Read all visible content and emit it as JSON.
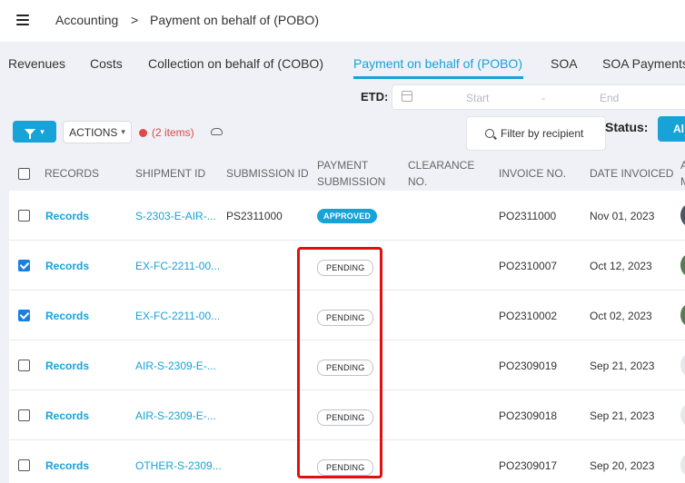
{
  "breadcrumb": {
    "parent": "Accounting",
    "separator": ">",
    "current": "Payment on behalf of (POBO)"
  },
  "tabs": [
    {
      "label": "Revenues"
    },
    {
      "label": "Costs"
    },
    {
      "label": "Collection on behalf of (COBO)"
    },
    {
      "label": "Payment on behalf of (POBO)",
      "active": true
    },
    {
      "label": "SOA"
    },
    {
      "label": "SOA Payments"
    }
  ],
  "filters": {
    "etd_label": "ETD:",
    "etd_start_placeholder": "Start",
    "etd_separator": "-",
    "etd_end_placeholder": "End",
    "actions_label": "ACTIONS",
    "items_label": "(2 items)",
    "recipient_label": "Filter by recipient",
    "status_label": "Status:",
    "status_value": "Al"
  },
  "table": {
    "headers": {
      "records": "RECORDS",
      "shipment_id": "SHIPMENT ID",
      "submission_id": "SUBMISSION ID",
      "payment_submission": "PAYMENT SUBMISSION",
      "clearance_no": "CLEARANCE NO.",
      "invoice_no": "INVOICE NO.",
      "date_invoiced": "DATE INVOICED",
      "assignee": "A M"
    },
    "rows": [
      {
        "checked": false,
        "records": "Records",
        "shipment_id": "S-2303-E-AIR-...",
        "submission_id": "PS2311000",
        "status": "APPROVED",
        "invoice_no": "PO2311000",
        "date_invoiced": "Nov 01, 2023"
      },
      {
        "checked": true,
        "records": "Records",
        "shipment_id": "EX-FC-2211-00...",
        "submission_id": "",
        "status": "PENDING",
        "invoice_no": "PO2310007",
        "date_invoiced": "Oct 12, 2023"
      },
      {
        "checked": true,
        "records": "Records",
        "shipment_id": "EX-FC-2211-00...",
        "submission_id": "",
        "status": "PENDING",
        "invoice_no": "PO2310002",
        "date_invoiced": "Oct 02, 2023"
      },
      {
        "checked": false,
        "records": "Records",
        "shipment_id": "AIR-S-2309-E-...",
        "submission_id": "",
        "status": "PENDING",
        "invoice_no": "PO2309019",
        "date_invoiced": "Sep 21, 2023"
      },
      {
        "checked": false,
        "records": "Records",
        "shipment_id": "AIR-S-2309-E-...",
        "submission_id": "",
        "status": "PENDING",
        "invoice_no": "PO2309018",
        "date_invoiced": "Sep 21, 2023"
      },
      {
        "checked": false,
        "records": "Records",
        "shipment_id": "OTHER-S-2309...",
        "submission_id": "",
        "status": "PENDING",
        "invoice_no": "PO2309017",
        "date_invoiced": "Sep 20, 2023"
      }
    ]
  },
  "colors": {
    "accent": "#17a2d8",
    "checkbox_checked": "#1a7fe0",
    "highlight": "#e01010",
    "items_red": "#e04848"
  }
}
